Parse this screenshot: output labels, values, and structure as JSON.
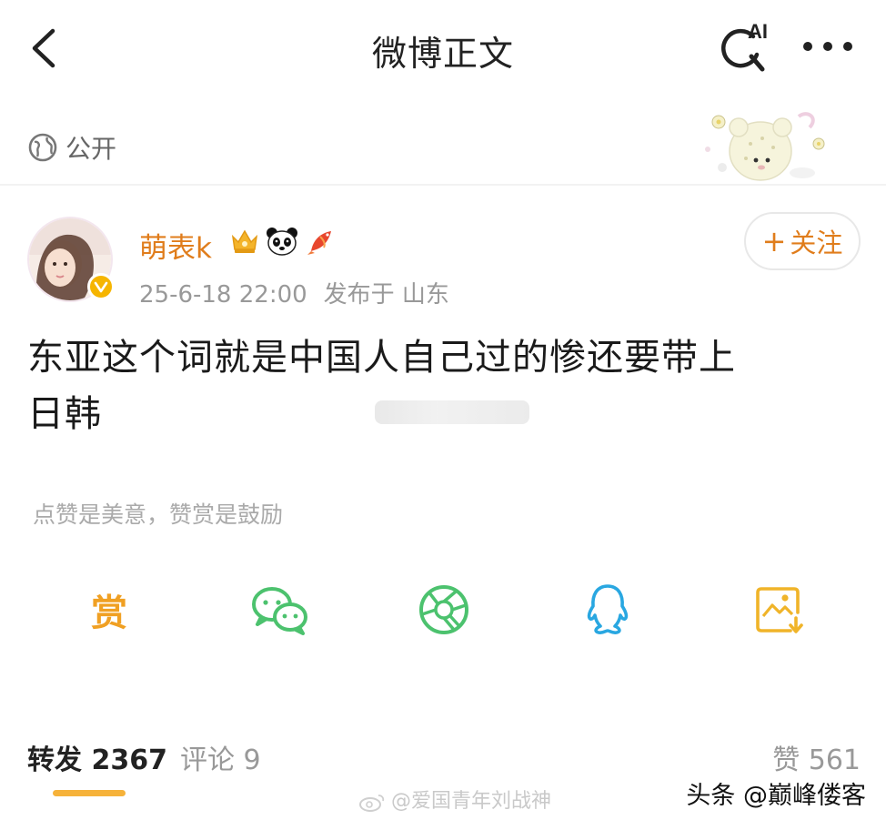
{
  "nav": {
    "title": "微博正文",
    "ai_label": "AI",
    "back_icon": "chevron-left-icon",
    "search_icon": "ai-search-icon",
    "more_icon": "more-dots-icon"
  },
  "visibility": {
    "icon": "globe-icon",
    "label": "公开"
  },
  "author": {
    "name": "萌表k",
    "badges": [
      "crown-icon",
      "panda-icon",
      "fish-icon"
    ],
    "verified": true,
    "date": "25-6-18 22:00",
    "location_label": "发布于 山东",
    "follow_label": "关注",
    "follow_plus": "+"
  },
  "post": {
    "line1": "东亚这个词就是中国人自己过的惨还要带上",
    "line2": "日韩"
  },
  "tip_hint": "点赞是美意，赞赏是鼓励",
  "share": {
    "reward_label": "赏",
    "items": [
      "reward-icon",
      "wechat-icon",
      "moments-icon",
      "qq-icon",
      "save-image-icon"
    ]
  },
  "tabs": {
    "repost": "转发 2367",
    "comment": "评论 9",
    "like": "赞 561"
  },
  "watermarks": {
    "center": "@爱国青年刘战神",
    "right": "头条 @巅峰偻客"
  },
  "colors": {
    "accent_orange": "#e07d1c",
    "tab_underline": "#f6b23a",
    "wechat_green": "#4cc26e",
    "qq_blue": "#29a7e1",
    "save_gold": "#f0b429"
  }
}
